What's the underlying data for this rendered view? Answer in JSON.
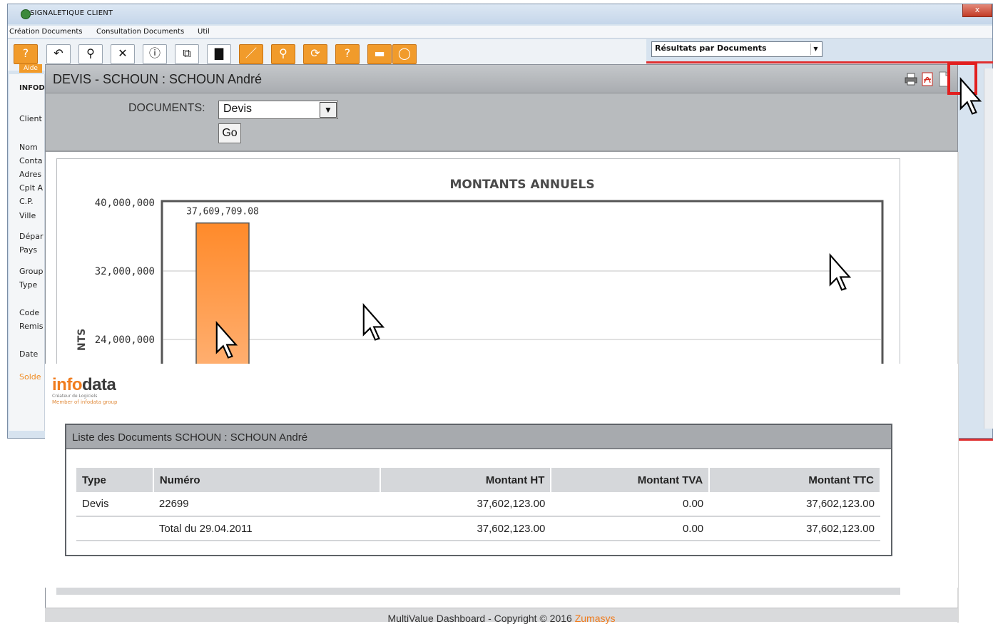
{
  "app": {
    "title": "SIGNALETIQUE CLIENT",
    "close_label": "x",
    "menu": [
      "Création Documents",
      "Consultation Documents",
      "Util"
    ],
    "toolbar_aide_label": "Aide",
    "toolbar_aide_glyph": "?",
    "results_select_value": "Résultats par Documents",
    "left_panel_labels": [
      "INFOD",
      "Client",
      "Nom",
      "Conta",
      "Adres",
      "Cplt A",
      "C.P.",
      "Ville",
      "Dépar",
      "Pays",
      "Group",
      "Type",
      "Code",
      "Remis",
      "Date",
      "Solde"
    ]
  },
  "dialog": {
    "title": "DEVIS - SCHOUN : SCHOUN André",
    "documents_label": "DOCUMENTS:",
    "documents_value": "Devis",
    "go_label": "Go",
    "icons": [
      "printer-icon",
      "pdf-icon",
      "document-icon"
    ]
  },
  "chart_data": {
    "type": "bar",
    "title": "MONTANTS ANNUELS",
    "ylabel": "NTS",
    "y_ticks": [
      "40,000,000",
      "32,000,000",
      "24,000,000"
    ],
    "ylim": [
      0,
      40000000
    ],
    "categories": [
      ""
    ],
    "values": [
      37609709.08
    ],
    "data_labels": [
      "37,609,709.08"
    ],
    "bar_color_top": "#ff8a2a",
    "bar_color_bottom": "#ffb47a",
    "grid": true
  },
  "report": {
    "logo_info": "info",
    "logo_data": "data",
    "logo_sub1": "Créateur de Logiciels",
    "logo_sub2": "Member of infodata group",
    "list_title": "Liste des Documents SCHOUN : SCHOUN André",
    "columns": [
      "Type",
      "Numéro",
      "Montant HT",
      "Montant TVA",
      "Montant TTC"
    ],
    "rows": [
      [
        "Devis",
        "22699",
        "37,602,123.00",
        "0.00",
        "37,602,123.00"
      ],
      [
        "",
        "Total du 29.04.2011",
        "37,602,123.00",
        "0.00",
        "37,602,123.00"
      ]
    ]
  },
  "footer": {
    "text": "MultiValue Dashboard - Copyright © 2016 ",
    "brand": "Zumasys"
  },
  "colors": {
    "accent_orange": "#f07c1e",
    "highlight_red": "#e21f1f"
  }
}
